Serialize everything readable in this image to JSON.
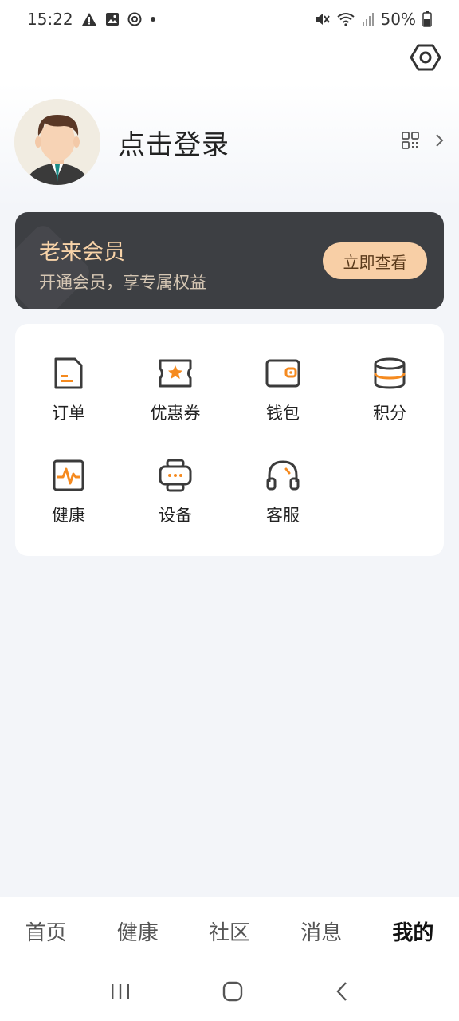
{
  "status_bar": {
    "time": "15:22",
    "battery": "50%"
  },
  "profile": {
    "login_label": "点击登录"
  },
  "membership": {
    "title": "老来会员",
    "subtitle": "开通会员，享专属权益",
    "button_label": "立即查看"
  },
  "services": {
    "items": [
      {
        "label": "订单",
        "icon": "order-icon"
      },
      {
        "label": "优惠券",
        "icon": "coupon-icon"
      },
      {
        "label": "钱包",
        "icon": "wallet-icon"
      },
      {
        "label": "积分",
        "icon": "points-icon"
      },
      {
        "label": "健康",
        "icon": "health-icon"
      },
      {
        "label": "设备",
        "icon": "device-icon"
      },
      {
        "label": "客服",
        "icon": "headset-icon"
      }
    ]
  },
  "bottom_nav": {
    "items": [
      {
        "label": "首页"
      },
      {
        "label": "健康"
      },
      {
        "label": "社区"
      },
      {
        "label": "消息"
      },
      {
        "label": "我的",
        "active": true
      }
    ]
  },
  "colors": {
    "accent": "#f58a1f",
    "card": "#3d3f43",
    "gold": "#f8d3a8"
  }
}
